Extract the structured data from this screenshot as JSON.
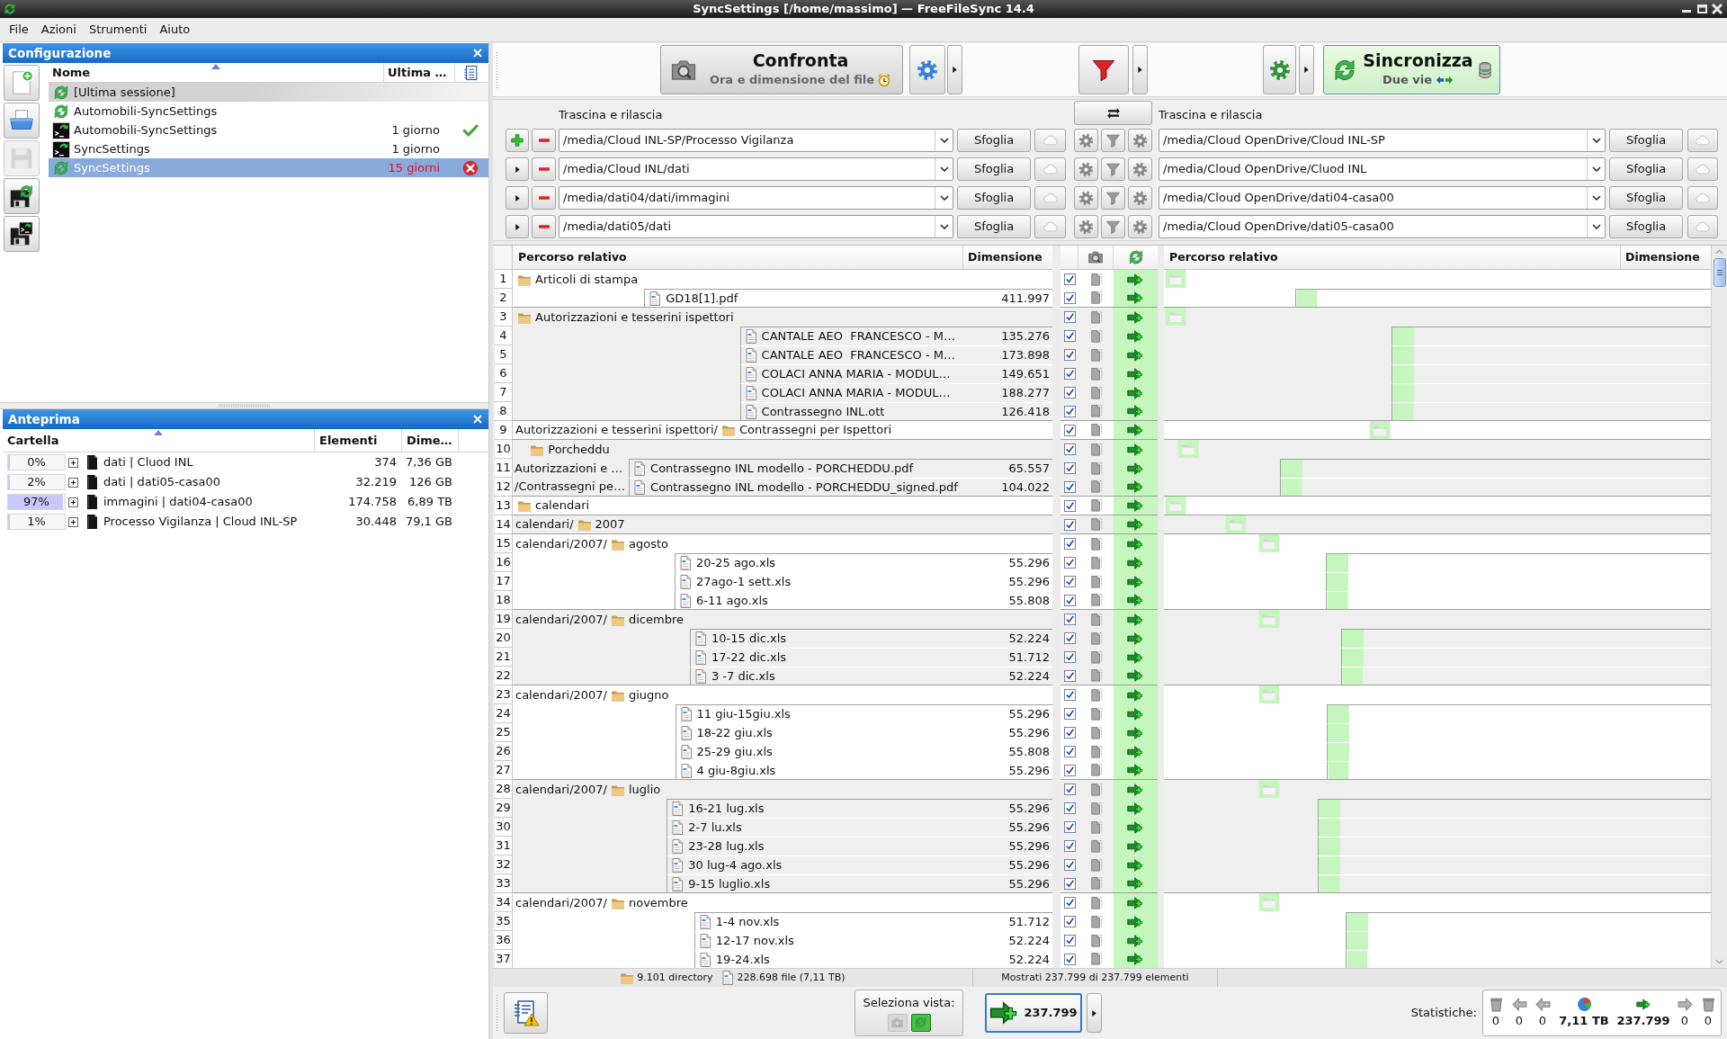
{
  "window": {
    "title": "SyncSettings [/home/massimo] — FreeFileSync 14.4"
  },
  "menu": [
    "File",
    "Azioni",
    "Strumenti",
    "Aiuto"
  ],
  "configuration_panel": {
    "title": "Configurazione",
    "toolbar": [
      {
        "kind": "new",
        "disabled": false
      },
      {
        "kind": "open",
        "disabled": false
      },
      {
        "kind": "save",
        "disabled": true
      },
      {
        "kind": "save_as",
        "disabled": false
      },
      {
        "kind": "save_as_batch",
        "disabled": false
      }
    ],
    "columns": [
      "Nome",
      "Ultima …"
    ],
    "items": [
      {
        "kind": "last_session",
        "name": "[Ultima sessione]",
        "success": false,
        "error": false,
        "selected": false
      },
      {
        "kind": "gui",
        "name": "Automobili-SyncSettings",
        "success": false,
        "error": false,
        "selected": false
      },
      {
        "kind": "batch",
        "name": "Automobili-SyncSettings",
        "last_sync": "1 giorno",
        "success": true,
        "error": false,
        "overdue": false,
        "selected": false
      },
      {
        "kind": "batch",
        "name": "SyncSettings",
        "last_sync": "1 giorno",
        "success": false,
        "error": false,
        "overdue": false,
        "selected": false
      },
      {
        "kind": "gui",
        "name": "SyncSettings",
        "last_sync": "15 giorni",
        "success": false,
        "error": true,
        "overdue": true,
        "selected": true
      }
    ]
  },
  "overview_panel": {
    "title": "Anteprima",
    "columns": [
      "Cartella",
      "Elementi",
      "Dime…"
    ],
    "rows": [
      {
        "share": "0%",
        "level": 0,
        "name": "dati | Cluod INL",
        "items": "374",
        "size": "7,36 GB"
      },
      {
        "share": "2%",
        "level": 0.02,
        "name": "dati | dati05-casa00",
        "items": "32.219",
        "size": "126 GB"
      },
      {
        "share": "97%",
        "level": 0.97,
        "name": "immagini | dati04-casa00",
        "items": "174.758",
        "size": "6,89 TB"
      },
      {
        "share": "1%",
        "level": 0.01,
        "name": "Processo Vigilanza | Cloud INL-SP",
        "items": "30.448",
        "size": "79,1 GB"
      }
    ]
  },
  "toolbar": {
    "compare": {
      "label": "Confronta",
      "variant": "Ora e dimensione del file"
    },
    "synchronize": {
      "label": "Sincronizza",
      "variant": "Due vie"
    }
  },
  "folder_pairs": {
    "left_label": "Trascina e rilascia",
    "right_label": "Trascina e rilascia",
    "pairs": [
      {
        "kind": "main",
        "left": "/media/Cloud INL-SP/Processo Vigilanza",
        "left_browse": "Sfoglia",
        "right": "/media/Cloud OpenDrive/Cloud INL-SP",
        "right_browse": "Sfoglia"
      },
      {
        "kind": "extra",
        "left": "/media/Cloud INL/dati",
        "left_browse": "Sfoglia",
        "right": "/media/Cloud OpenDrive/Cluod INL",
        "right_browse": "Sfoglia"
      },
      {
        "kind": "extra",
        "left": "/media/dati04/dati/immagini",
        "left_browse": "Sfoglia",
        "right": "/media/Cloud OpenDrive/dati04-casa00",
        "right_browse": "Sfoglia"
      },
      {
        "kind": "extra",
        "left": "/media/dati05/dati",
        "left_browse": "Sfoglia",
        "right": "/media/Cloud OpenDrive/dati05-casa00",
        "right_browse": "Sfoglia"
      }
    ]
  },
  "file_grid": {
    "left_columns": [
      "Percorso relativo",
      "Dimensione"
    ],
    "right_columns": [
      "Percorso relativo",
      "Dimensione"
    ],
    "groups": [
      {
        "rows": [
          {
            "number": "1",
            "kind": "folder",
            "name": "Articoli di stampa",
            "checked": true
          },
          {
            "number": "2",
            "kind": "file",
            "name": "GD18[1].pdf",
            "size": "411.997",
            "checked": true
          }
        ]
      },
      {
        "rows": [
          {
            "number": "3",
            "kind": "folder",
            "name": "Autorizzazioni e tesserini ispettori",
            "checked": true
          },
          {
            "number": "4",
            "kind": "file",
            "name": "CANTALE AEO  FRANCESCO - M…",
            "size": "135.276",
            "checked": true
          },
          {
            "number": "5",
            "kind": "file",
            "name": "CANTALE AEO  FRANCESCO - M…",
            "size": "173.898",
            "checked": true
          },
          {
            "number": "6",
            "kind": "file",
            "name": "COLACI ANNA MARIA - MODUL…",
            "size": "149.651",
            "checked": true
          },
          {
            "number": "7",
            "kind": "file",
            "name": "COLACI ANNA MARIA - MODUL…",
            "size": "188.277",
            "checked": true
          },
          {
            "number": "8",
            "kind": "file",
            "name": "Contrassegno INL.ott",
            "size": "126.418",
            "checked": true
          }
        ]
      },
      {
        "rows": [
          {
            "number": "9",
            "kind": "folder",
            "parent": "Autorizzazioni e tesserini ispettori/",
            "name": "Contrassegni per Ispettori",
            "checked": true
          }
        ]
      },
      {
        "rows": [
          {
            "number": "10",
            "kind": "folder",
            "name": "Porcheddu",
            "checked": true
          },
          {
            "number": "11",
            "kind": "file",
            "lead": "Autorizzazioni e …",
            "name": "Contrassegno INL modello - PORCHEDDU.pdf",
            "size": "65.557",
            "checked": true
          },
          {
            "number": "12",
            "kind": "file",
            "lead": "/Contrassegni pe…",
            "name": "Contrassegno INL modello - PORCHEDDU_signed.pdf",
            "size": "104.022",
            "checked": true
          }
        ]
      },
      {
        "rows": [
          {
            "number": "13",
            "kind": "folder",
            "name": "calendari",
            "checked": true
          }
        ]
      },
      {
        "rows": [
          {
            "number": "14",
            "kind": "folder",
            "parent": "calendari/",
            "name": "2007",
            "checked": true
          }
        ]
      },
      {
        "rows": [
          {
            "number": "15",
            "kind": "folder",
            "parent": "calendari/2007/",
            "name": "agosto",
            "checked": true
          },
          {
            "number": "16",
            "kind": "file",
            "name": "20-25 ago.xls",
            "size": "55.296",
            "checked": true
          },
          {
            "number": "17",
            "kind": "file",
            "name": "27ago-1 sett.xls",
            "size": "55.296",
            "checked": true
          },
          {
            "number": "18",
            "kind": "file",
            "name": "6-11 ago.xls",
            "size": "55.808",
            "checked": true
          }
        ]
      },
      {
        "rows": [
          {
            "number": "19",
            "kind": "folder",
            "parent": "calendari/2007/",
            "name": "dicembre",
            "checked": true
          },
          {
            "number": "20",
            "kind": "file",
            "name": "10-15 dic.xls",
            "size": "52.224",
            "checked": true
          },
          {
            "number": "21",
            "kind": "file",
            "name": "17-22 dic.xls",
            "size": "51.712",
            "checked": true
          },
          {
            "number": "22",
            "kind": "file",
            "name": "3 -7 dic.xls",
            "size": "52.224",
            "checked": true
          }
        ]
      },
      {
        "rows": [
          {
            "number": "23",
            "kind": "folder",
            "parent": "calendari/2007/",
            "name": "giugno",
            "checked": true
          },
          {
            "number": "24",
            "kind": "file",
            "name": "11 giu-15giu.xls",
            "size": "55.296",
            "checked": true
          },
          {
            "number": "25",
            "kind": "file",
            "name": "18-22 giu.xls",
            "size": "55.296",
            "checked": true
          },
          {
            "number": "26",
            "kind": "file",
            "name": "25-29 giu.xls",
            "size": "55.808",
            "checked": true
          },
          {
            "number": "27",
            "kind": "file",
            "name": "4 giu-8giu.xls",
            "size": "55.296",
            "checked": true
          }
        ]
      },
      {
        "rows": [
          {
            "number": "28",
            "kind": "folder",
            "parent": "calendari/2007/",
            "name": "luglio",
            "checked": true
          },
          {
            "number": "29",
            "kind": "file",
            "name": "16-21 lug.xls",
            "size": "55.296",
            "checked": true
          },
          {
            "number": "30",
            "kind": "file",
            "name": "2-7 lu.xls",
            "size": "55.296",
            "checked": true
          },
          {
            "number": "31",
            "kind": "file",
            "name": "23-28 lug.xls",
            "size": "55.296",
            "checked": true
          },
          {
            "number": "32",
            "kind": "file",
            "name": "30 lug-4 ago.xls",
            "size": "55.296",
            "checked": true
          },
          {
            "number": "33",
            "kind": "file",
            "name": "9-15 luglio.xls",
            "size": "55.296",
            "checked": true
          }
        ]
      },
      {
        "rows": [
          {
            "number": "34",
            "kind": "folder",
            "parent": "calendari/2007/",
            "name": "novembre",
            "checked": true
          },
          {
            "number": "35",
            "kind": "file",
            "name": "1-4 nov.xls",
            "size": "51.712",
            "checked": true
          },
          {
            "number": "36",
            "kind": "file",
            "name": "12-17 nov.xls",
            "size": "52.224",
            "checked": true
          },
          {
            "number": "37",
            "kind": "file",
            "name": "19-24.xls",
            "size": "52.224",
            "checked": true
          }
        ]
      }
    ]
  },
  "status_bar": {
    "directories": "9.101 directory",
    "files": "228.698 file (7,11 TB)",
    "shown": "Mostrati 237.799 di 237.799 elementi"
  },
  "bottom_bar": {
    "view_label": "Seleziona vista:",
    "view_buttons": [
      {
        "kind": "compare",
        "selected": false
      },
      {
        "kind": "sync",
        "selected": true
      }
    ],
    "sync_count": "237.799",
    "statistics_label": "Statistiche:",
    "statistics": [
      {
        "kind": "delete_left",
        "value": "0",
        "active": false
      },
      {
        "kind": "update_left",
        "value": "0",
        "active": false
      },
      {
        "kind": "create_left",
        "value": "0",
        "active": false
      },
      {
        "kind": "data",
        "value": "7,11 TB",
        "active": true
      },
      {
        "kind": "create_right",
        "value": "237.799",
        "active": true
      },
      {
        "kind": "update_right",
        "value": "0",
        "active": false
      },
      {
        "kind": "delete_right",
        "value": "0",
        "active": false
      }
    ]
  }
}
